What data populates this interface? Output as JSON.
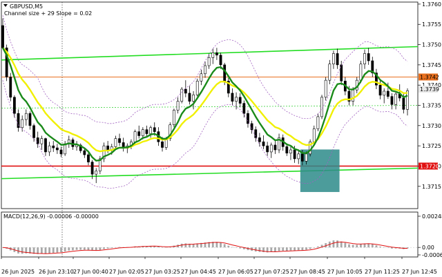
{
  "chart_data": {
    "type": "candlestick",
    "symbol_label": "GBPUSD,M5",
    "indicator_label": "Channel size + 29 Slope = 0.02",
    "price_axis": {
      "ylim": [
        1.37095,
        1.37605
      ],
      "ticks": [
        "1.3760",
        "1.3755",
        "1.3750",
        "1.3745",
        "1.3740",
        "1.3735",
        "1.3730",
        "1.3725",
        "1.3720",
        "1.3715"
      ]
    },
    "time_labels": [
      "26 Jun 2025",
      "26 Jun 23:10",
      "27 Jun 00:40",
      "27 Jun 02:05",
      "27 Jun 03:25",
      "27 Jun 04:45",
      "27 Jun 06:05",
      "27 Jun 07:25",
      "27 Jun 08:45",
      "27 Jun 10:05",
      "27 Jun 11:25",
      "27 Jun 12:45"
    ],
    "current_price": {
      "value": 1.3739,
      "label": "1.3739"
    },
    "resistance_line": {
      "value": 1.3742,
      "label": "1.3742",
      "color": "#e8701e"
    },
    "support_line": {
      "value": 1.372,
      "label": "1.3720",
      "color": "#e01010"
    },
    "upper_channel": {
      "from": 1.37462,
      "to": 1.37495,
      "color": "#22dd22"
    },
    "lower_channel": {
      "from": 1.37169,
      "to": 1.37195,
      "color": "#22dd22"
    },
    "mid_channel_slope": {
      "from": 1.37343,
      "to": 1.3735,
      "color": "#22cc22"
    },
    "highlight_zone": {
      "from_index": 77,
      "to_index": 86,
      "y_top": 1.37241,
      "y_bottom": 1.37136,
      "color": "#2e8b8b"
    },
    "candles": [
      [
        1.37547,
        1.37565,
        1.3749,
        1.37492
      ],
      [
        1.37492,
        1.375,
        1.3741,
        1.3742
      ],
      [
        1.3742,
        1.3743,
        1.3736,
        1.3737
      ],
      [
        1.3737,
        1.37375,
        1.3732,
        1.3733
      ],
      [
        1.3733,
        1.3734,
        1.37285,
        1.37295
      ],
      [
        1.37295,
        1.37325,
        1.37285,
        1.37315
      ],
      [
        1.37315,
        1.3734,
        1.373,
        1.3733
      ],
      [
        1.3733,
        1.37335,
        1.3729,
        1.373
      ],
      [
        1.373,
        1.37305,
        1.3726,
        1.3727
      ],
      [
        1.3727,
        1.37285,
        1.37245,
        1.37255
      ],
      [
        1.37255,
        1.37275,
        1.3724,
        1.37268
      ],
      [
        1.37268,
        1.3727,
        1.37225,
        1.37235
      ],
      [
        1.37235,
        1.3726,
        1.37225,
        1.3725
      ],
      [
        1.3725,
        1.37262,
        1.37235,
        1.37245
      ],
      [
        1.37245,
        1.37255,
        1.3723,
        1.3724
      ],
      [
        1.3724,
        1.37248,
        1.37222,
        1.3723
      ],
      [
        1.3723,
        1.37262,
        1.37225,
        1.37255
      ],
      [
        1.37255,
        1.37275,
        1.37245,
        1.37265
      ],
      [
        1.37265,
        1.3727,
        1.3724,
        1.37248
      ],
      [
        1.37248,
        1.37262,
        1.37238,
        1.37252
      ],
      [
        1.37252,
        1.37256,
        1.37232,
        1.37238
      ],
      [
        1.37238,
        1.37246,
        1.3722,
        1.37228
      ],
      [
        1.37228,
        1.37236,
        1.37202,
        1.3721
      ],
      [
        1.3721,
        1.37215,
        1.37168,
        1.3718
      ],
      [
        1.3718,
        1.37195,
        1.37158,
        1.37188
      ],
      [
        1.37188,
        1.37225,
        1.3718,
        1.37218
      ],
      [
        1.37218,
        1.37258,
        1.3721,
        1.3725
      ],
      [
        1.3725,
        1.37262,
        1.37232,
        1.3724
      ],
      [
        1.3724,
        1.37255,
        1.37228,
        1.37248
      ],
      [
        1.37248,
        1.37275,
        1.3724,
        1.37268
      ],
      [
        1.37268,
        1.3728,
        1.3725,
        1.37258
      ],
      [
        1.37258,
        1.3727,
        1.37236,
        1.37244
      ],
      [
        1.37244,
        1.37256,
        1.37232,
        1.3725
      ],
      [
        1.3725,
        1.37266,
        1.37242,
        1.3726
      ],
      [
        1.3726,
        1.3729,
        1.37255,
        1.37285
      ],
      [
        1.37285,
        1.373,
        1.37268,
        1.37275
      ],
      [
        1.37275,
        1.37296,
        1.37266,
        1.3729
      ],
      [
        1.3729,
        1.373,
        1.37272,
        1.3728
      ],
      [
        1.3728,
        1.373,
        1.3727,
        1.37295
      ],
      [
        1.37295,
        1.37308,
        1.37275,
        1.37285
      ],
      [
        1.37285,
        1.37296,
        1.3725,
        1.3726
      ],
      [
        1.3726,
        1.37272,
        1.37236,
        1.37246
      ],
      [
        1.37246,
        1.37272,
        1.3724,
        1.37268
      ],
      [
        1.37268,
        1.37308,
        1.37262,
        1.37302
      ],
      [
        1.37302,
        1.37342,
        1.37296,
        1.37338
      ],
      [
        1.37338,
        1.3737,
        1.3733,
        1.3736
      ],
      [
        1.3736,
        1.37395,
        1.37355,
        1.3739
      ],
      [
        1.3739,
        1.37412,
        1.3737,
        1.3738
      ],
      [
        1.3738,
        1.37398,
        1.37352,
        1.3736
      ],
      [
        1.3736,
        1.37385,
        1.3734,
        1.37376
      ],
      [
        1.37376,
        1.37416,
        1.37372,
        1.3741
      ],
      [
        1.3741,
        1.37438,
        1.374,
        1.37428
      ],
      [
        1.37428,
        1.37458,
        1.37418,
        1.37448
      ],
      [
        1.37448,
        1.37478,
        1.3744,
        1.37468
      ],
      [
        1.37468,
        1.3749,
        1.37452,
        1.3748
      ],
      [
        1.3748,
        1.37492,
        1.37462,
        1.37474
      ],
      [
        1.37474,
        1.3748,
        1.3744,
        1.3745
      ],
      [
        1.3745,
        1.37455,
        1.374,
        1.3741
      ],
      [
        1.3741,
        1.37418,
        1.3737,
        1.3738
      ],
      [
        1.3738,
        1.37392,
        1.3735,
        1.3736
      ],
      [
        1.3736,
        1.37382,
        1.3734,
        1.3737
      ],
      [
        1.3737,
        1.3738,
        1.37345,
        1.37355
      ],
      [
        1.37355,
        1.37362,
        1.3732,
        1.3733
      ],
      [
        1.3733,
        1.37338,
        1.37295,
        1.37305
      ],
      [
        1.37305,
        1.37312,
        1.3728,
        1.3729
      ],
      [
        1.3729,
        1.37298,
        1.3726,
        1.3727
      ],
      [
        1.3727,
        1.37282,
        1.37248,
        1.3726
      ],
      [
        1.3726,
        1.37276,
        1.37242,
        1.3725
      ],
      [
        1.3725,
        1.3726,
        1.37225,
        1.37235
      ],
      [
        1.37235,
        1.37258,
        1.3722,
        1.37252
      ],
      [
        1.37252,
        1.37262,
        1.3723,
        1.3724
      ],
      [
        1.3724,
        1.3728,
        1.37232,
        1.3727
      ],
      [
        1.3727,
        1.37278,
        1.37238,
        1.37248
      ],
      [
        1.37248,
        1.37256,
        1.37225,
        1.37232
      ],
      [
        1.37232,
        1.37248,
        1.37215,
        1.3724
      ],
      [
        1.3724,
        1.3725,
        1.37208,
        1.37218
      ],
      [
        1.37218,
        1.37238,
        1.37205,
        1.3723
      ],
      [
        1.3723,
        1.3724,
        1.37202,
        1.37212
      ],
      [
        1.37212,
        1.37236,
        1.37204,
        1.3723
      ],
      [
        1.3723,
        1.37266,
        1.37224,
        1.3726
      ],
      [
        1.3726,
        1.373,
        1.37254,
        1.37292
      ],
      [
        1.37292,
        1.3733,
        1.37286,
        1.37322
      ],
      [
        1.37322,
        1.37376,
        1.37316,
        1.3737
      ],
      [
        1.3737,
        1.3742,
        1.37362,
        1.37412
      ],
      [
        1.37412,
        1.37462,
        1.37402,
        1.37452
      ],
      [
        1.37452,
        1.37485,
        1.3744,
        1.37478
      ],
      [
        1.37478,
        1.3749,
        1.3744,
        1.3745
      ],
      [
        1.3745,
        1.3746,
        1.374,
        1.3741
      ],
      [
        1.3741,
        1.3742,
        1.37375,
        1.37385
      ],
      [
        1.37385,
        1.37398,
        1.3735,
        1.3736
      ],
      [
        1.3736,
        1.37395,
        1.3735,
        1.37388
      ],
      [
        1.37388,
        1.3742,
        1.3738,
        1.37412
      ],
      [
        1.37412,
        1.3746,
        1.37405,
        1.37452
      ],
      [
        1.37452,
        1.37488,
        1.3744,
        1.37478
      ],
      [
        1.37478,
        1.37492,
        1.3745,
        1.3746
      ],
      [
        1.3746,
        1.3747,
        1.3742,
        1.3743
      ],
      [
        1.3743,
        1.3744,
        1.3739,
        1.374
      ],
      [
        1.374,
        1.37415,
        1.37365,
        1.37375
      ],
      [
        1.37375,
        1.37392,
        1.37355,
        1.37385
      ],
      [
        1.37385,
        1.37406,
        1.37366,
        1.37372
      ],
      [
        1.37372,
        1.3738,
        1.3734,
        1.37352
      ],
      [
        1.37352,
        1.37385,
        1.3734,
        1.37378
      ],
      [
        1.37378,
        1.37402,
        1.3736,
        1.37368
      ],
      [
        1.37368,
        1.3738,
        1.3733,
        1.3734
      ],
      [
        1.3734,
        1.37392,
        1.37325,
        1.37386
      ]
    ],
    "ma_fast_color": "#1a8a1a",
    "ma_slow_color": "#f0f000",
    "macd": {
      "label": "MACD(12,26,9) -0.00006 -0.00000",
      "ticks": [
        "0.00248",
        "0.00",
        "-0.00067"
      ],
      "signal_color": "#e01010",
      "histogram_color": "#a8a8a8"
    }
  }
}
